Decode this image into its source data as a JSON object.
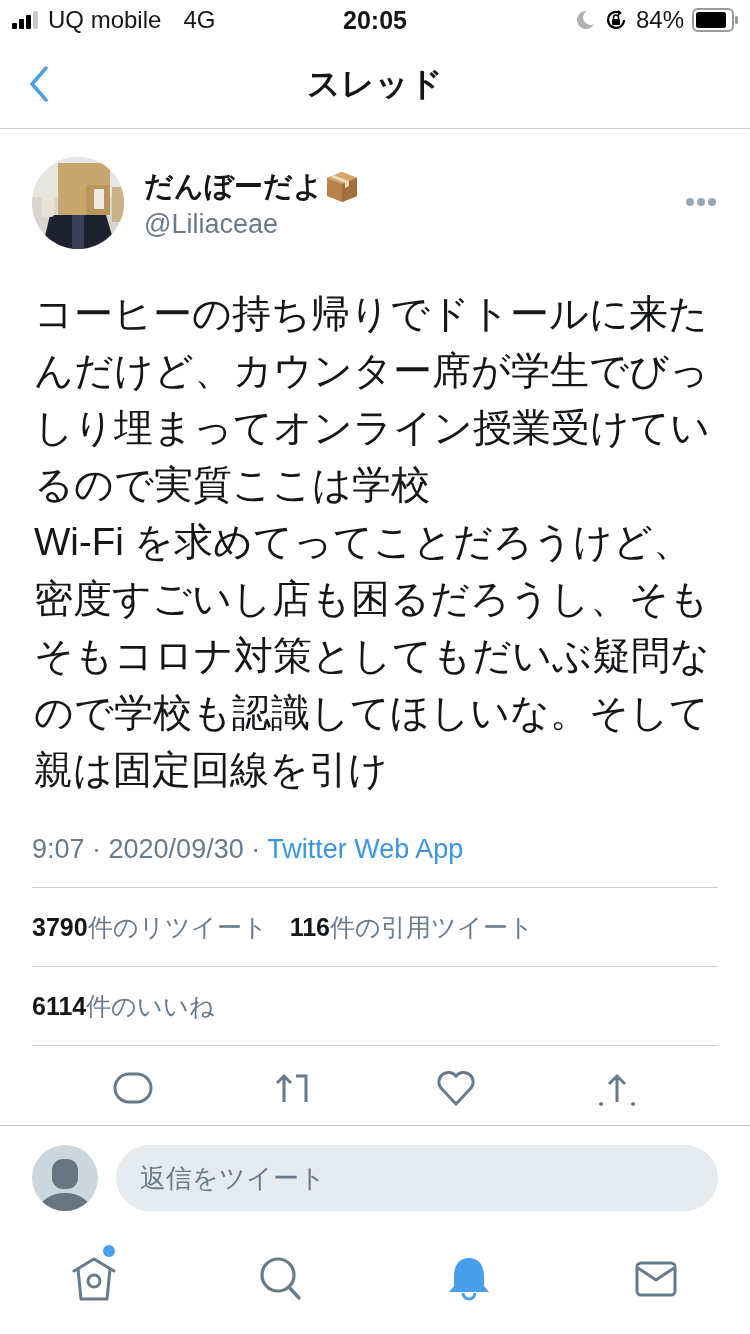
{
  "status_bar": {
    "carrier": "UQ mobile",
    "network": "4G",
    "time": "20:05",
    "battery": "84%"
  },
  "nav": {
    "title": "スレッド"
  },
  "tweet": {
    "name": "だんぼーだよ",
    "handle": "@Liliaceae",
    "body": "コーヒーの持ち帰りでドトールに来たんだけど、カウンター席が学生でびっしり埋まってオンライン授業受けているので実質ここは学校\nWi-Fi を求めてってことだろうけど、密度すごいし店も困るだろうし、そもそもコロナ対策としてもだいぶ疑問なので学校も認識してほしいな。そして親は固定回線を引け",
    "time": "9:07 · 2020/09/30 · ",
    "source": "Twitter Web App",
    "stats": [
      {
        "text": "**3790**件のリツイート"
      },
      {
        "text": "**116**件の引用ツイート"
      }
    ],
    "likes": "**6114**件のいいね"
  },
  "reply": {
    "placeholder": "返信をツイート"
  },
  "tabs": [
    {
      "kind": "home",
      "selected": false,
      "badge": true
    },
    {
      "kind": "search",
      "selected": false,
      "badge": false
    },
    {
      "kind": "notifications",
      "selected": true,
      "badge": false
    },
    {
      "kind": "messages",
      "selected": false,
      "badge": false
    }
  ]
}
